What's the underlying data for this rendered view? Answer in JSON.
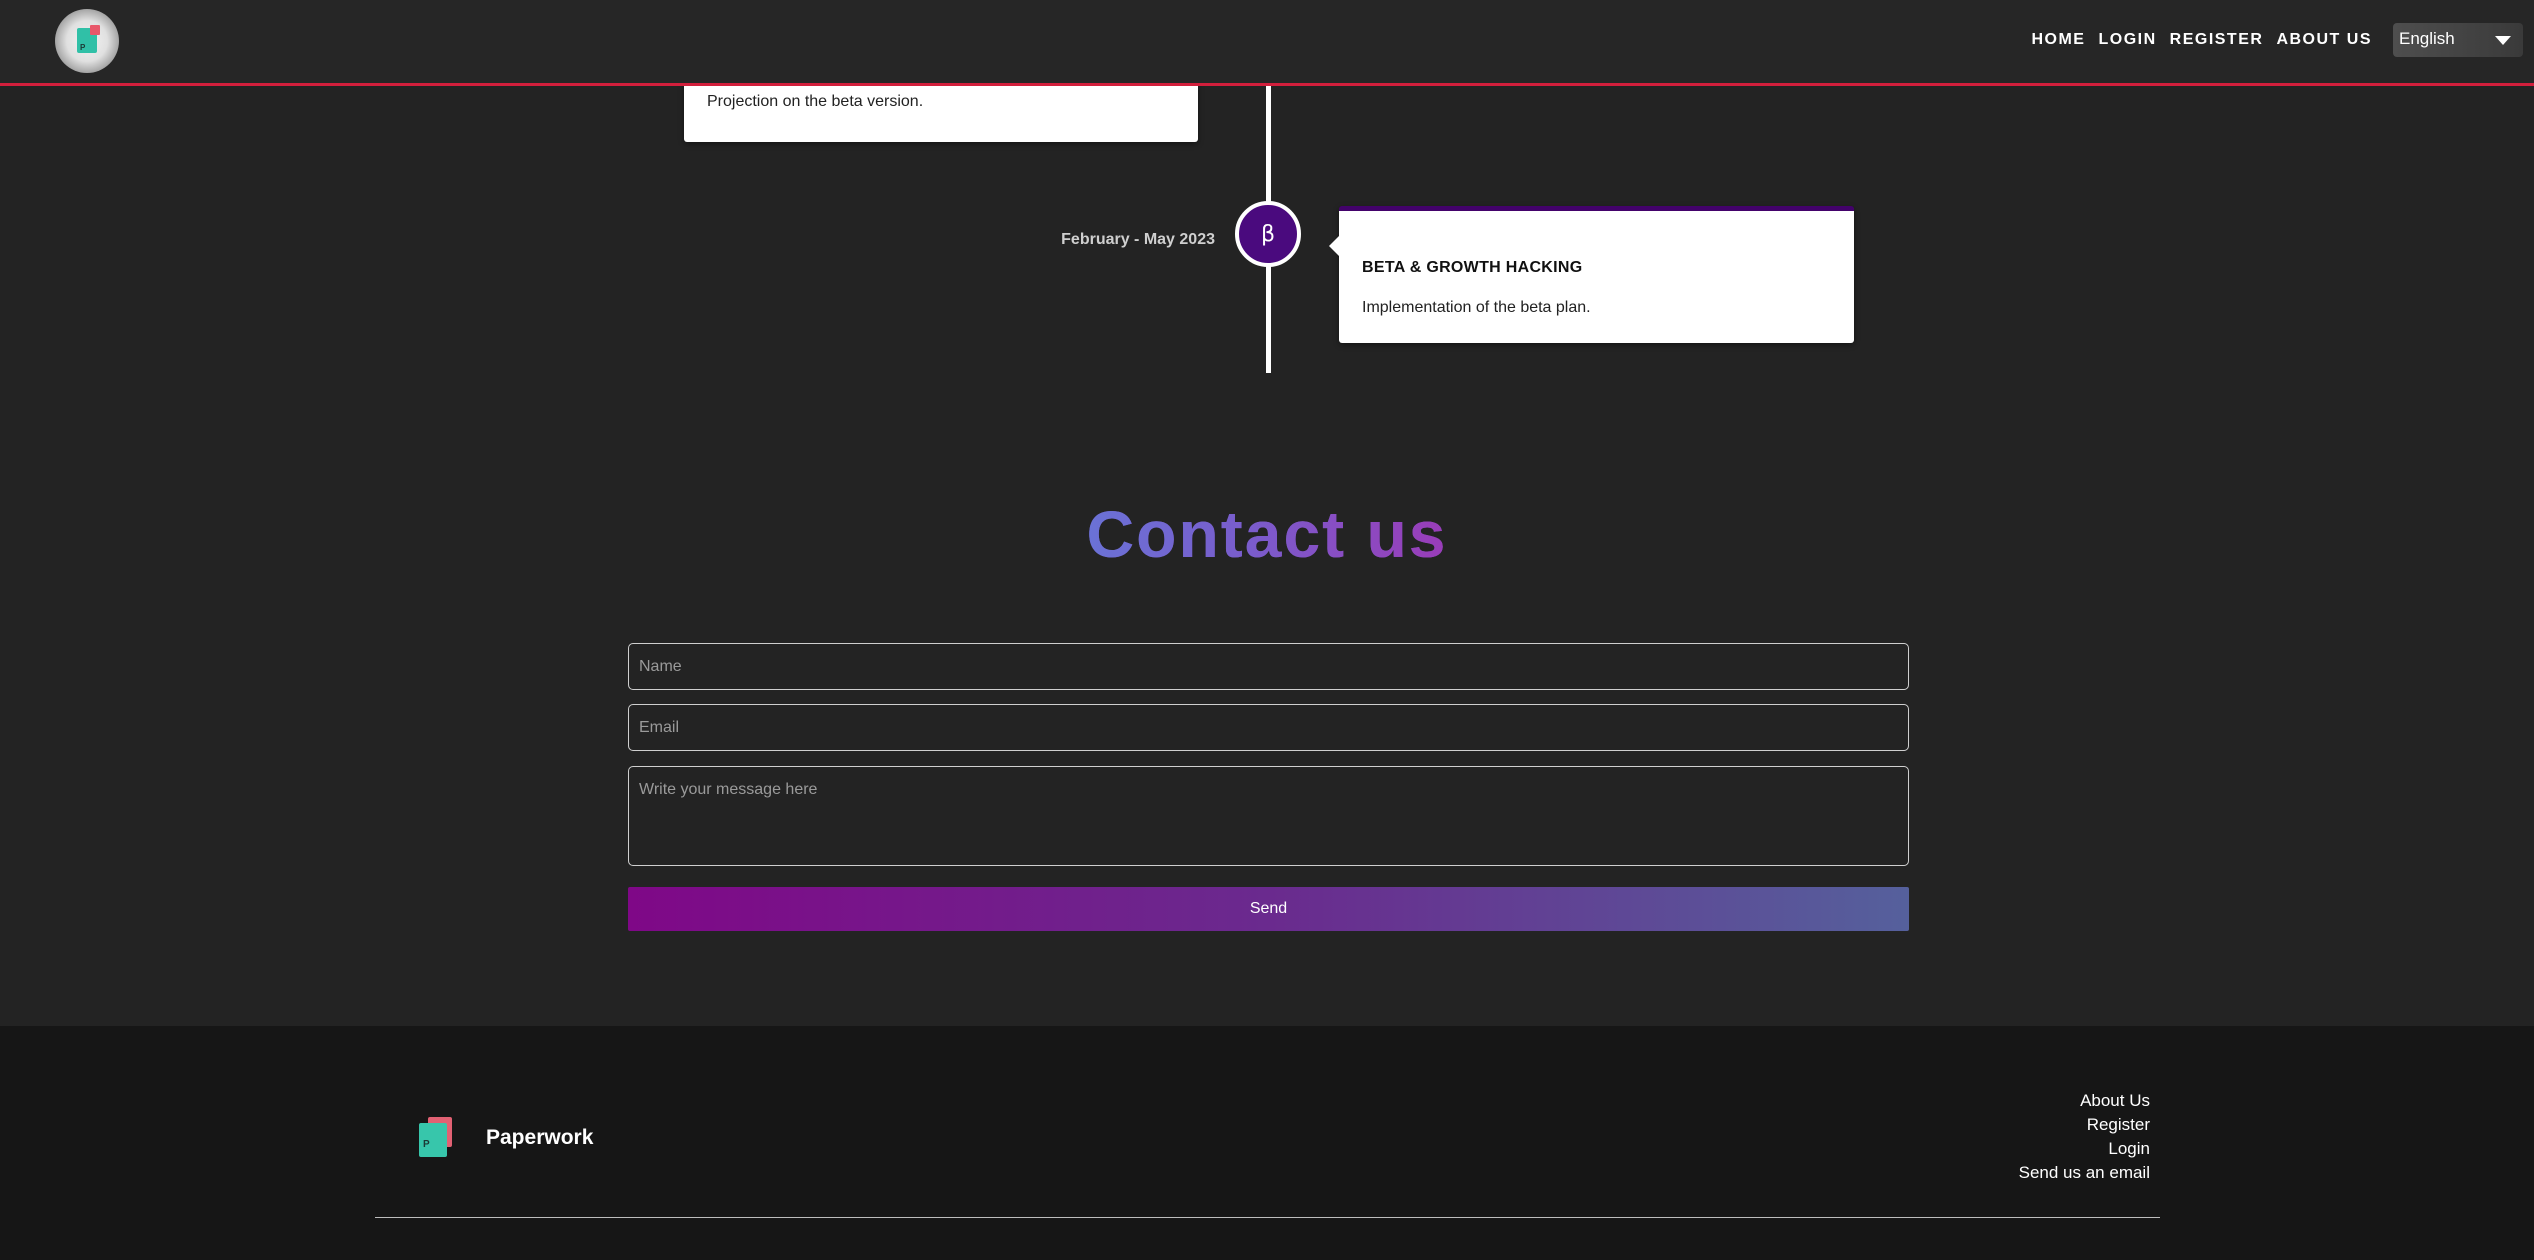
{
  "navbar": {
    "links": [
      "HOME",
      "LOGIN",
      "REGISTER",
      "ABOUT US"
    ],
    "language": "English",
    "accent_color": "#d21f3c"
  },
  "timeline": {
    "previous_item": {
      "description": "Projection on the beta version."
    },
    "current_item": {
      "date": "February - May 2023",
      "symbol": "β",
      "title": "BETA & GROWTH HACKING",
      "description": "Implementation of the beta plan.",
      "accent_color": "#43026b"
    }
  },
  "contact": {
    "title": "Contact us",
    "name_placeholder": "Name",
    "email_placeholder": "Email",
    "message_placeholder": "Write your message here",
    "send_label": "Send"
  },
  "footer": {
    "brand": "Paperwork",
    "links": [
      "About Us",
      "Register",
      "Login",
      "Send us an email"
    ]
  }
}
